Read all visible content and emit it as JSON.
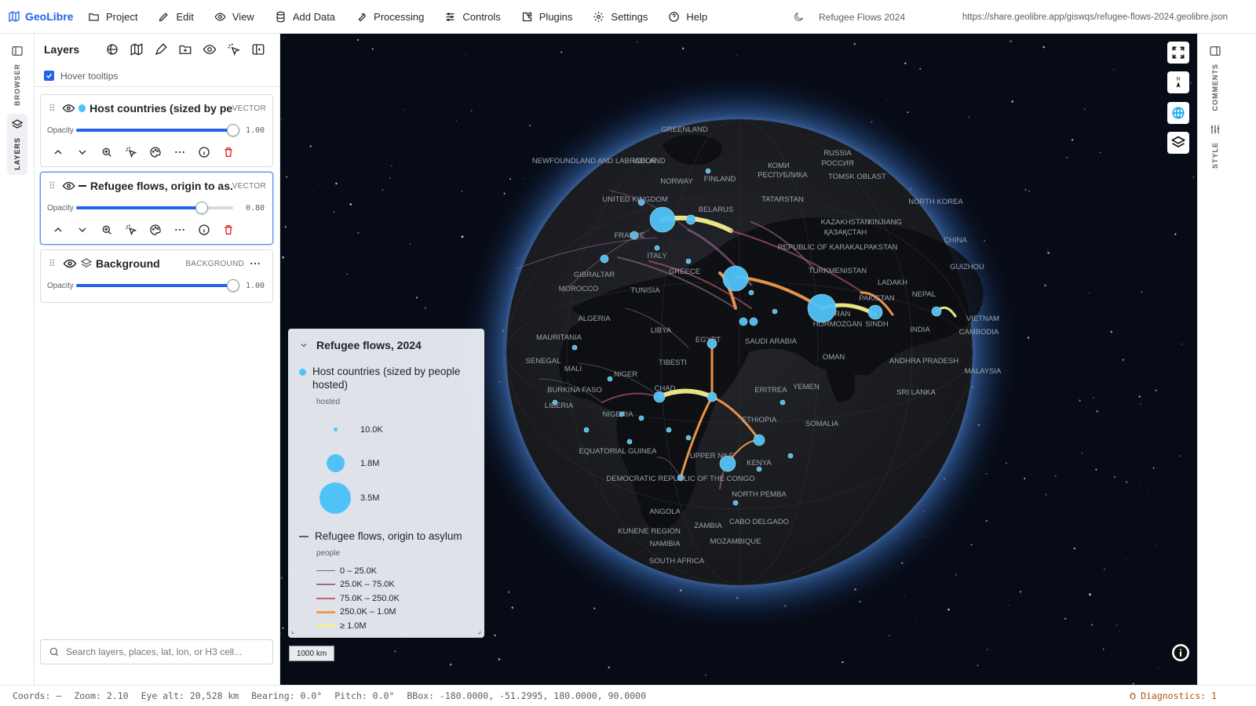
{
  "app": {
    "name": "GeoLibre",
    "project_title": "Refugee Flows 2024",
    "url": "https://share.geolibre.app/giswqs/refugee-flows-2024.geolibre.json"
  },
  "menu": [
    {
      "label": "Project",
      "icon": "folder-icon"
    },
    {
      "label": "Edit",
      "icon": "pencil-icon"
    },
    {
      "label": "View",
      "icon": "eye-icon"
    },
    {
      "label": "Add Data",
      "icon": "database-icon"
    },
    {
      "label": "Processing",
      "icon": "wrench-icon"
    },
    {
      "label": "Controls",
      "icon": "sliders-icon"
    },
    {
      "label": "Plugins",
      "icon": "puzzle-icon"
    },
    {
      "label": "Settings",
      "icon": "gear-icon"
    },
    {
      "label": "Help",
      "icon": "help-icon"
    }
  ],
  "left_rail": {
    "browser": "BROWSER",
    "layers": "LAYERS"
  },
  "right_rail": {
    "comments": "COMMENTS",
    "style": "STYLE"
  },
  "panel": {
    "title": "Layers",
    "hover_tooltips": "Hover tooltips",
    "layers": [
      {
        "name": "Host countries (sized by pe...",
        "type": "VECTOR",
        "opacity_label": "Opacity",
        "opacity": 1.0,
        "opacity_text": "1.00",
        "swatch": "#4fc3f7"
      },
      {
        "name": "Refugee flows, origin to as...",
        "type": "VECTOR",
        "opacity_label": "Opacity",
        "opacity": 0.8,
        "opacity_text": "0.80",
        "swatch": "#1f2328"
      },
      {
        "name": "Background",
        "type": "BACKGROUND",
        "opacity_label": "Opacity",
        "opacity": 1.0,
        "opacity_text": "1.00"
      }
    ],
    "search_placeholder": "Search layers, places, lat, lon, or H3 cell..."
  },
  "legend": {
    "title": "Refugee flows, 2024",
    "host": {
      "title": "Host countries (sized by people hosted)",
      "field": "hosted",
      "sizes": [
        {
          "label": "10.0K",
          "value": 10000
        },
        {
          "label": "1.8M",
          "value": 1800000
        },
        {
          "label": "3.5M",
          "value": 3500000
        }
      ]
    },
    "flows": {
      "title": "Refugee flows, origin to asylum",
      "field": "people",
      "classes": [
        {
          "label": "0 – 25.0K",
          "color": "#6b7280"
        },
        {
          "label": "25.0K – 75.0K",
          "color": "#9b6b8f"
        },
        {
          "label": "75.0K – 250.0K",
          "color": "#c4607c"
        },
        {
          "label": "250.0K – 1.0M",
          "color": "#f29a4c"
        },
        {
          "label": "≥ 1.0M",
          "color": "#f5ef8a"
        }
      ]
    }
  },
  "scale_bar": "1000 km",
  "map_labels": [
    "GREENLAND",
    "ICELAND",
    "NEWFOUNDLAND AND LABRADOR",
    "NORWAY",
    "FINLAND",
    "RUSSIA",
    "РОССИЯ",
    "КОМИ",
    "РЕСПУБЛИКА",
    "TOMSK OBLAST",
    "UNITED KINGDOM",
    "TATARSTAN",
    "KAZAKHSTAN",
    "ҚАЗАҚСТАН",
    "XINJIANG",
    "NORTH KOREA",
    "FRANCE",
    "ITALY",
    "BELARUS",
    "REPUBLIC OF KARAKALPAKSTAN",
    "TURKMENISTAN",
    "CHINA",
    "GIBRALTAR",
    "MOROCCO",
    "TUNISIA",
    "GREECE",
    "LADAKH",
    "NEPAL",
    "PAKISTAN",
    "GUIZHOU",
    "ALGERIA",
    "LIBYA",
    "EGYPT",
    "SAUDI ARABIA",
    "IRAN",
    "HORMOZGAN",
    "SINDH",
    "INDIA",
    "VIETNAM",
    "CAMBODIA",
    "MAURITANIA",
    "SENEGAL",
    "MALI",
    "NIGER",
    "TIBESTI",
    "OMAN",
    "ANDHRA PRADESH",
    "MALAYSIA",
    "BURKINA FASO",
    "CHAD",
    "ERITREA",
    "YEMEN",
    "SRI LANKA",
    "NIGERIA",
    "ETHIOPIA",
    "SOMALIA",
    "EQUATORIAL GUINEA",
    "UPPER NILE",
    "KENYA",
    "DEMOCRATIC REPUBLIC OF THE CONGO",
    "NORTH PEMBA",
    "ANGOLA",
    "ZAMBIA",
    "CABO DELGADO",
    "KUNENE REGION",
    "NAMIBIA",
    "MOZAMBIQUE",
    "SOUTH AFRICA",
    "LIBERIA"
  ],
  "status": {
    "coords": "Coords: —",
    "zoom": "Zoom: 2.10",
    "eye_alt": "Eye alt: 20,528 km",
    "bearing": "Bearing: 0.0°",
    "pitch": "Pitch: 0.0°",
    "bbox": "BBox: -180.0000, -51.2995, 180.0000, 90.0000",
    "diagnostics": "Diagnostics: 1"
  },
  "colors": {
    "accent": "#2563eb",
    "host_fill": "#4fc3f7",
    "space": "#070b16",
    "globe": "#1d1f24"
  }
}
